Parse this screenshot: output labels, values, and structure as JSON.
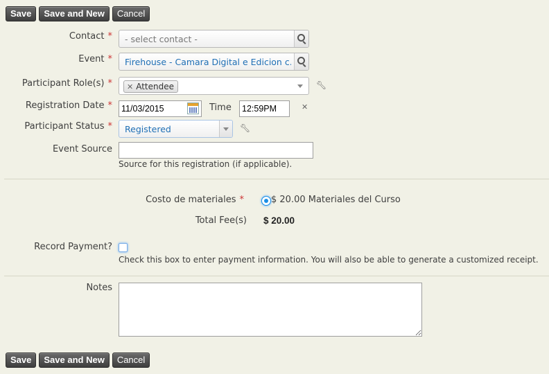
{
  "toolbar": {
    "save_label": "Save",
    "save_new_label": "Save and New",
    "cancel_label": "Cancel"
  },
  "form": {
    "contact": {
      "label": "Contact",
      "placeholder": "- select contact -"
    },
    "event": {
      "label": "Event",
      "value": "Firehouse - Camara Digital e Edicion c..."
    },
    "participant_role": {
      "label": "Participant Role(s)",
      "tag": "Attendee"
    },
    "registration_date": {
      "label": "Registration Date",
      "date": "11/03/2015",
      "time_label": "Time",
      "time": "12:59PM"
    },
    "participant_status": {
      "label": "Participant Status",
      "value": "Registered"
    },
    "event_source": {
      "label": "Event Source",
      "value": "",
      "hint": "Source for this registration (if applicable)."
    },
    "required_mark": "*"
  },
  "fees": {
    "cost_label": "Costo de materiales",
    "cost_option": "$ 20.00 Materiales del Curso",
    "total_label": "Total Fee(s)",
    "total_value": "$ 20.00"
  },
  "payment": {
    "label": "Record Payment?",
    "checked": false,
    "hint": "Check this box to enter payment information. You will also be able to generate a customized receipt."
  },
  "notes": {
    "label": "Notes",
    "value": ""
  },
  "colors": {
    "button_bg": "#4a4a4a",
    "required": "#cc3333",
    "link_blue": "#1f6fb5",
    "page_bg": "#f1f1e6"
  }
}
